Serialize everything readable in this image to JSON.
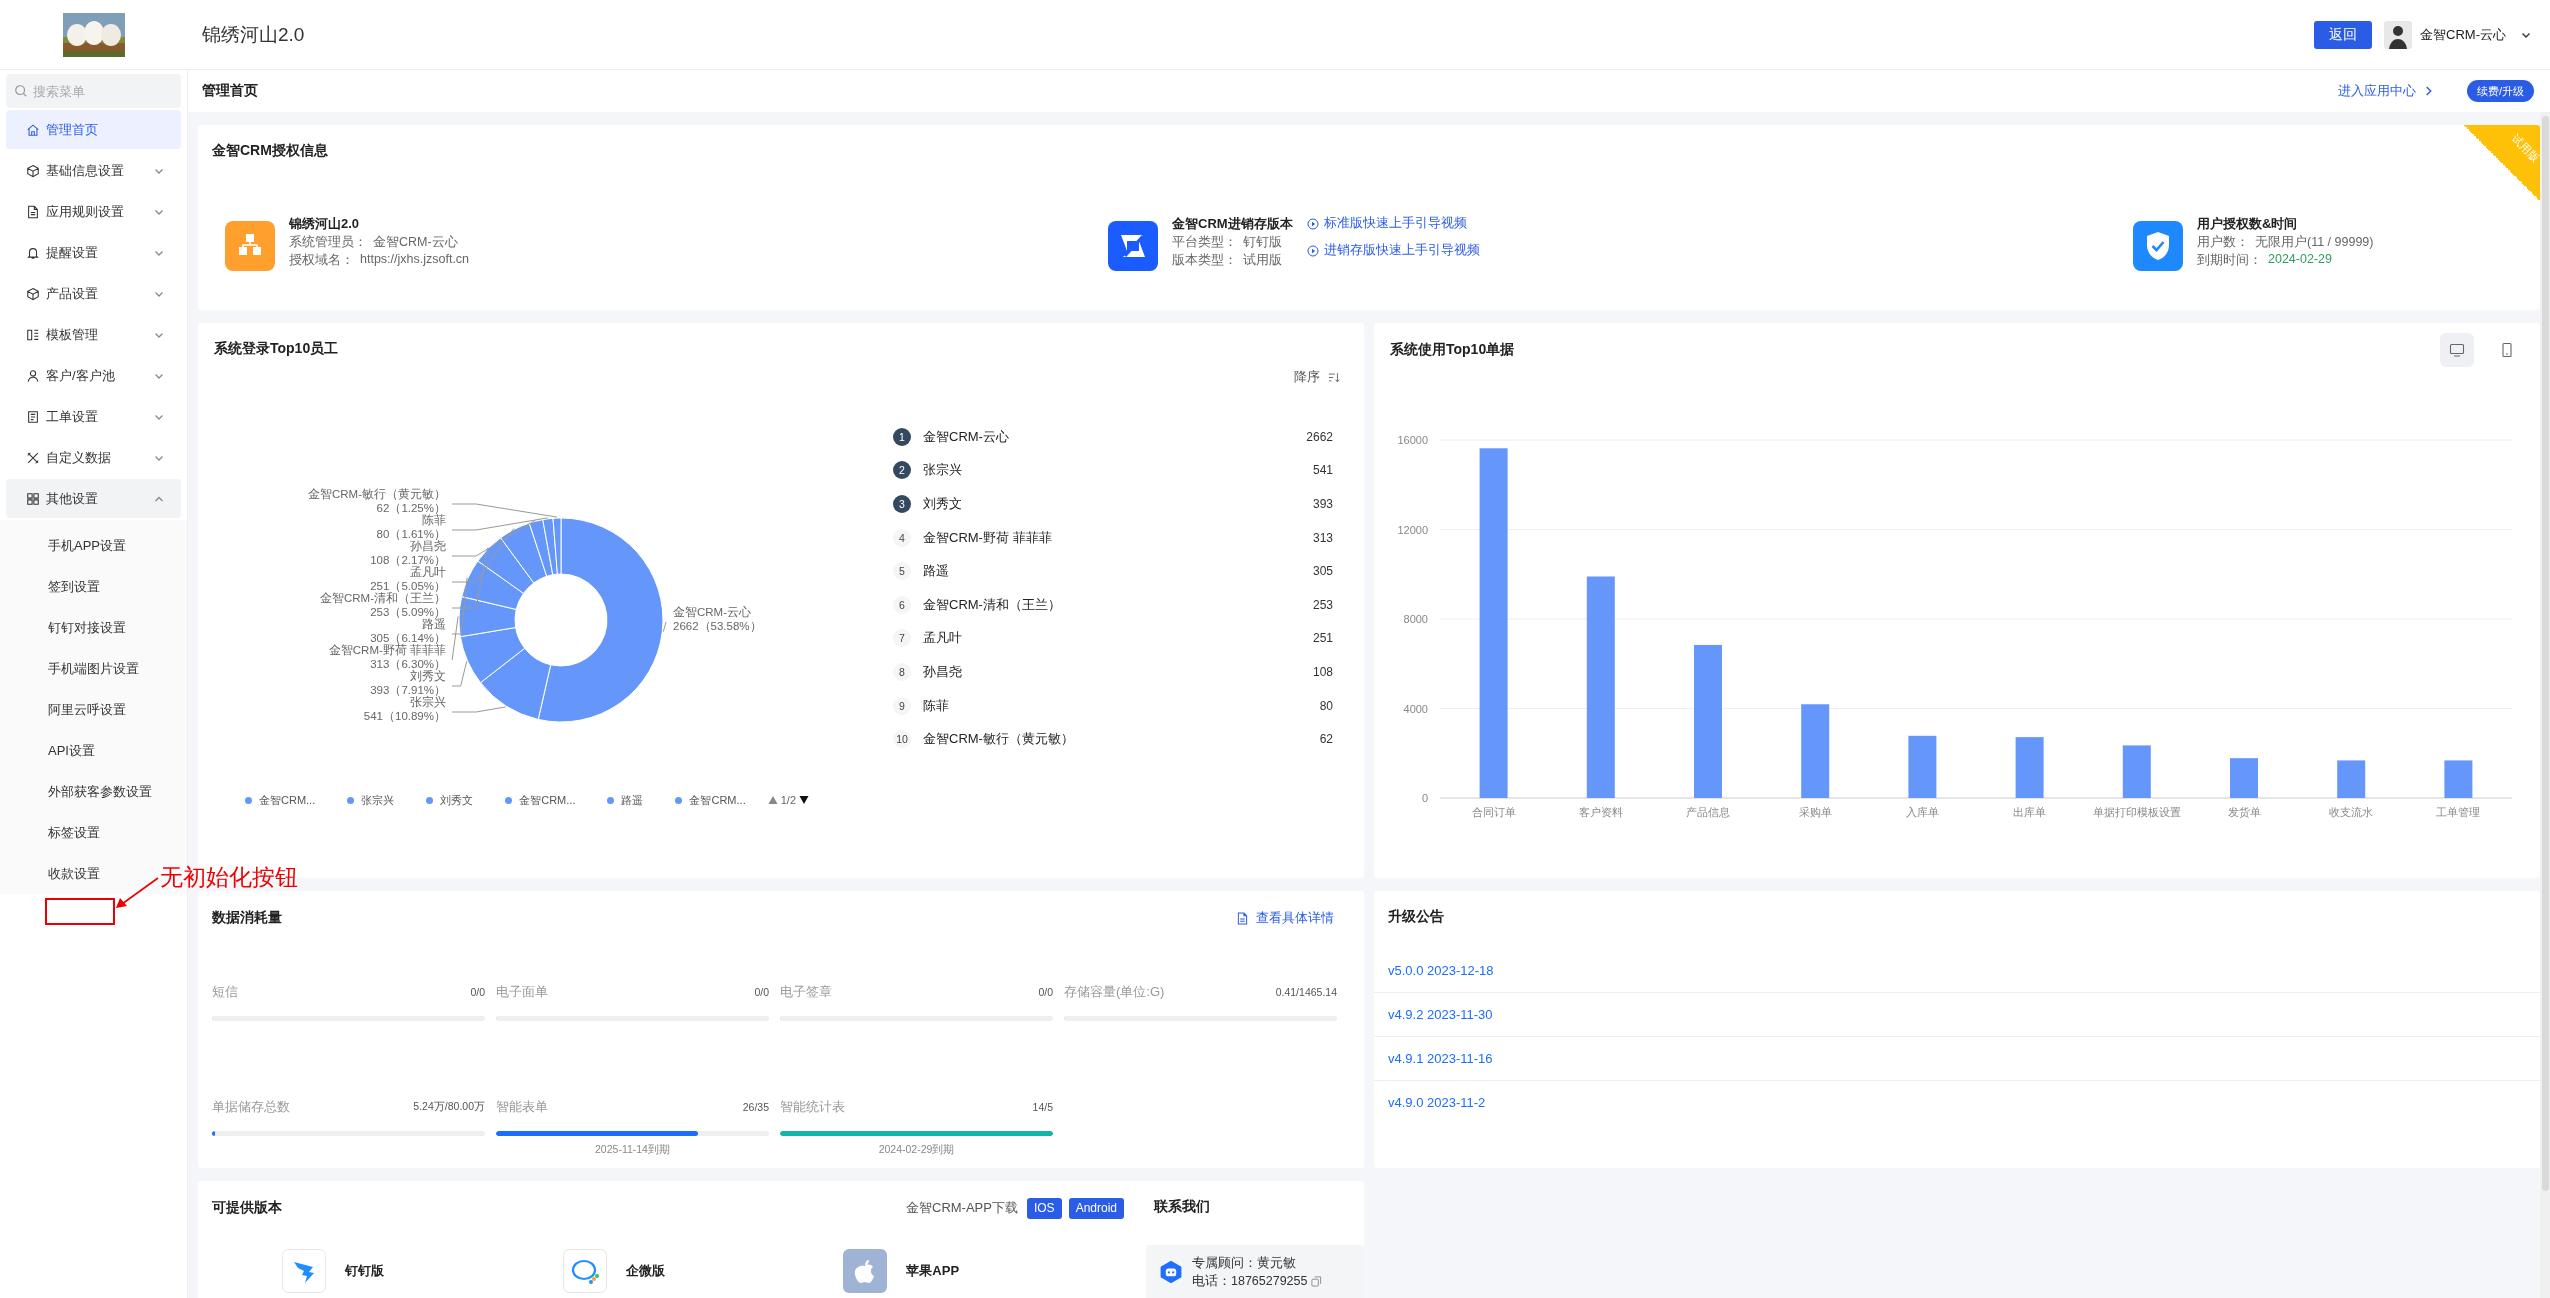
{
  "header": {
    "title": "锦绣河山2.0",
    "back_button": "返回",
    "user": {
      "name": "金智CRM-云心"
    }
  },
  "sidebar": {
    "search": {
      "placeholder": "搜索菜单"
    },
    "items": [
      {
        "label": "管理首页",
        "kind": "link",
        "selected": true
      },
      {
        "label": "基础信息设置",
        "kind": "group",
        "expanded": false,
        "selected": false
      },
      {
        "label": "应用规则设置",
        "kind": "group",
        "expanded": false,
        "selected": false
      },
      {
        "label": "提醒设置",
        "kind": "group",
        "expanded": false,
        "selected": false
      },
      {
        "label": "产品设置",
        "kind": "group",
        "expanded": false,
        "selected": false
      },
      {
        "label": "模板管理",
        "kind": "group",
        "expanded": false,
        "selected": false
      },
      {
        "label": "客户/客户池",
        "kind": "group",
        "expanded": false,
        "selected": false
      },
      {
        "label": "工单设置",
        "kind": "group",
        "expanded": false,
        "selected": false
      },
      {
        "label": "自定义数据",
        "kind": "group",
        "expanded": false,
        "selected": false
      },
      {
        "label": "其他设置",
        "kind": "group",
        "expanded": true,
        "selected": false,
        "children": [
          {
            "label": "手机APP设置",
            "selected": false
          },
          {
            "label": "签到设置",
            "selected": false
          },
          {
            "label": "钉钉对接设置",
            "selected": false
          },
          {
            "label": "手机端图片设置",
            "selected": false
          },
          {
            "label": "阿里云呼设置",
            "selected": false
          },
          {
            "label": "API设置",
            "selected": false
          },
          {
            "label": "外部获客参数设置",
            "selected": false
          },
          {
            "label": "标签设置",
            "selected": false
          },
          {
            "label": "收款设置",
            "selected": false
          }
        ]
      }
    ]
  },
  "annotation": {
    "text": "无初始化按钮"
  },
  "page_bar": {
    "title": "管理首页",
    "app_center_link": "进入应用中心",
    "renew_button": "续费/升级"
  },
  "license": {
    "title": "金智CRM授权信息",
    "ribbon": "试用版",
    "blocks": [
      {
        "title": "锦绣河山2.0",
        "fields": [
          {
            "label": "系统管理员：",
            "value": "金智CRM-云心",
            "color": "#666666"
          },
          {
            "label": "授权域名：",
            "value": "https://jxhs.jzsoft.cn",
            "color": "#666666"
          }
        ]
      },
      {
        "title": "金智CRM进销存版本",
        "fields": [
          {
            "label": "平台类型：",
            "value": "钉钉版",
            "color": "#666666"
          },
          {
            "label": "版本类型：",
            "value": "试用版",
            "color": "#666666"
          }
        ],
        "links": [
          "标准版快速上手引导视频",
          "进销存版快速上手引导视频"
        ]
      },
      {
        "title": "用户授权数&时间",
        "fields": [
          {
            "label": "用户数：",
            "value": "无限用户(11 / 99999)",
            "color": "#666666"
          },
          {
            "label": "到期时间：",
            "value": "2024-02-29",
            "color": "#2e9e5b"
          }
        ]
      }
    ]
  },
  "login_top": {
    "title": "系统登录Top10员工",
    "sort": "降序",
    "chart_data": {
      "type": "donut",
      "categories": [
        "金智CRM-云心",
        "张宗兴",
        "刘秀文",
        "金智CRM-野荷 菲菲菲",
        "路遥",
        "金智CRM-清和（王兰）",
        "孟凡叶",
        "孙昌尧",
        "陈菲",
        "金智CRM-敏行（黄元敏）"
      ],
      "values": [
        2662,
        541,
        393,
        313,
        305,
        253,
        251,
        108,
        80,
        62
      ],
      "value_labels": [
        "2662（53.58%）",
        "541（10.89%）",
        "393（7.91%）",
        "313（6.30%）",
        "305（6.14%）",
        "253（5.09%）",
        "251（5.05%）",
        "108（2.17%）",
        "80（1.61%）",
        "62（1.25%）"
      ]
    },
    "legend": {
      "items": [
        "金智CRM...",
        "张宗兴",
        "刘秀文",
        "金智CRM...",
        "路遥",
        "金智CRM..."
      ],
      "page": "1/2"
    },
    "ranking": [
      {
        "rank": "1",
        "name": "金智CRM-云心",
        "count": "2662",
        "highlighted": true
      },
      {
        "rank": "2",
        "name": "张宗兴",
        "count": "541",
        "highlighted": true
      },
      {
        "rank": "3",
        "name": "刘秀文",
        "count": "393",
        "highlighted": true
      },
      {
        "rank": "4",
        "name": "金智CRM-野荷 菲菲菲",
        "count": "313",
        "highlighted": false
      },
      {
        "rank": "5",
        "name": "路遥",
        "count": "305",
        "highlighted": false
      },
      {
        "rank": "6",
        "name": "金智CRM-清和（王兰）",
        "count": "253",
        "highlighted": false
      },
      {
        "rank": "7",
        "name": "孟凡叶",
        "count": "251",
        "highlighted": false
      },
      {
        "rank": "8",
        "name": "孙昌尧",
        "count": "108",
        "highlighted": false
      },
      {
        "rank": "9",
        "name": "陈菲",
        "count": "80",
        "highlighted": false
      },
      {
        "rank": "10",
        "name": "金智CRM-敏行（黄元敏）",
        "count": "62",
        "highlighted": false
      }
    ]
  },
  "usage_top": {
    "title": "系统使用Top10单据",
    "view_toggle": [
      {
        "kind": "desktop",
        "selected": true
      },
      {
        "kind": "mobile",
        "selected": false
      }
    ],
    "chart_data": {
      "type": "bar",
      "categories": [
        "合同订单",
        "客户资料",
        "产品信息",
        "采购单",
        "入库单",
        "出库单",
        "单据打印模板设置",
        "发货单",
        "收支流水",
        "工单管理"
      ],
      "values": [
        15630,
        9900,
        6840,
        4190,
        2780,
        2720,
        2350,
        1780,
        1680,
        1680
      ],
      "ylim": [
        0,
        16000
      ],
      "yticks": [
        0,
        4000,
        8000,
        12000,
        16000
      ],
      "grid": true
    }
  },
  "consumption": {
    "title": "数据消耗量",
    "details_link": "查看具体详情",
    "meters": [
      {
        "label": "短信",
        "reading": "0/0",
        "level": 0
      },
      {
        "label": "电子面单",
        "reading": "0/0",
        "level": 0
      },
      {
        "label": "电子签章",
        "reading": "0/0",
        "level": 0
      },
      {
        "label": "存储容量(单位:G)",
        "reading": "0.41/1465.14",
        "level": 0
      },
      {
        "label": "单据储存总数",
        "reading": "5.24万/80.00万",
        "level": 0.01,
        "color": "#1a6dff"
      },
      {
        "label": "智能表单",
        "reading": "26/35",
        "level": 0.74,
        "color": "#1a6dff",
        "note": "2025-11-14到期"
      },
      {
        "label": "智能统计表",
        "reading": "14/5",
        "level": 1,
        "color": "#13b5a6",
        "note": "2024-02-29到期"
      }
    ]
  },
  "announcements": {
    "title": "升级公告",
    "items": [
      "v5.0.0 2023-12-18",
      "v4.9.2 2023-11-30",
      "v4.9.1 2023-11-16",
      "v4.9.0 2023-11-2"
    ]
  },
  "editions": {
    "title": "可提供版本",
    "items": [
      {
        "label": "钉钉版"
      },
      {
        "label": "企微版"
      },
      {
        "label": "苹果APP"
      }
    ],
    "app_download": {
      "label": "金智CRM-APP下载",
      "buttons": [
        "IOS",
        "Android"
      ]
    }
  },
  "contact": {
    "title": "联系我们",
    "advisor": "专属顾问：黄元敏",
    "phone": "电话：18765279255"
  }
}
